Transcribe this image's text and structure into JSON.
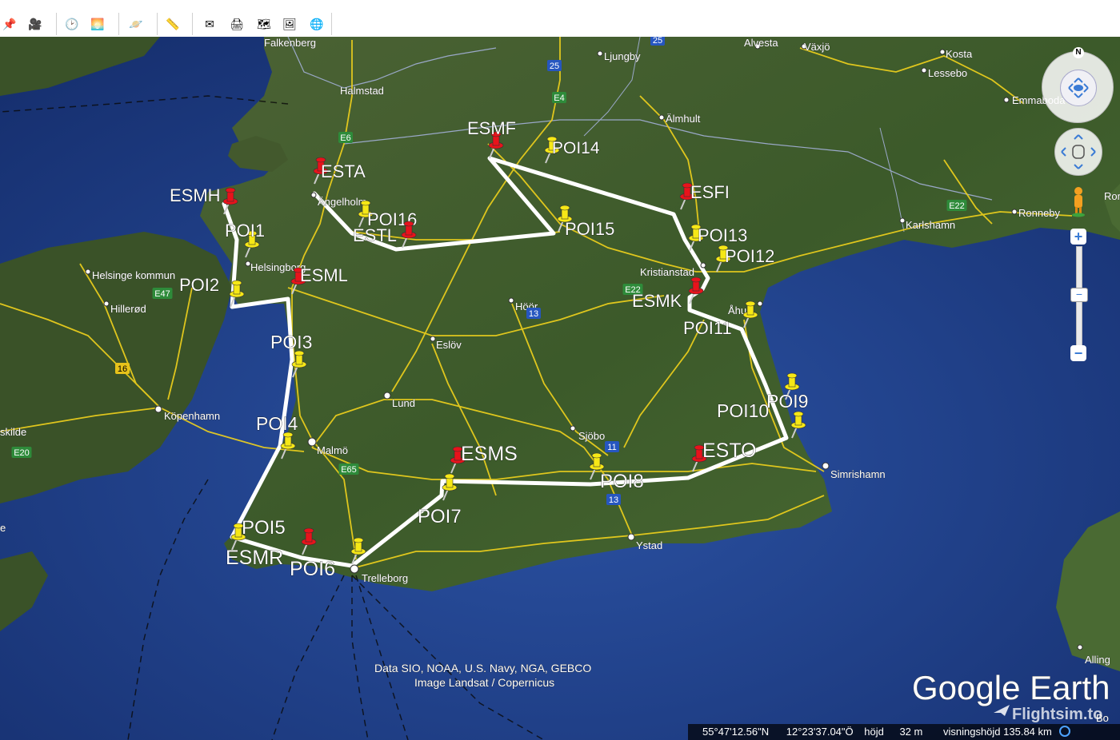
{
  "toolbar": {
    "buttons": [
      {
        "icon": "add-placemark-icon"
      },
      {
        "icon": "add-tour-icon"
      },
      {
        "icon": "historical-imagery-icon"
      },
      {
        "icon": "sunlight-icon"
      },
      {
        "icon": "planets-icon"
      },
      {
        "icon": "ruler-icon"
      },
      {
        "icon": "email-icon"
      },
      {
        "icon": "print-icon"
      },
      {
        "icon": "view-in-maps-icon"
      },
      {
        "icon": "save-image-icon"
      },
      {
        "icon": "globe-icon"
      }
    ]
  },
  "markers": [
    {
      "id": "ESMF",
      "color": "red"
    },
    {
      "id": "POI14",
      "color": "yellow"
    },
    {
      "id": "ESTA",
      "color": "red"
    },
    {
      "id": "ESMH",
      "color": "red"
    },
    {
      "id": "POI16",
      "color": "yellow"
    },
    {
      "id": "ESTL",
      "color": "red"
    },
    {
      "id": "POI15",
      "color": "yellow"
    },
    {
      "id": "ESFI",
      "color": "red"
    },
    {
      "id": "POI1",
      "color": "yellow"
    },
    {
      "id": "POI13",
      "color": "yellow"
    },
    {
      "id": "POI12",
      "color": "yellow"
    },
    {
      "id": "ESML",
      "color": "red"
    },
    {
      "id": "POI2",
      "color": "yellow"
    },
    {
      "id": "ESMK",
      "color": "red"
    },
    {
      "id": "POI11",
      "color": "yellow"
    },
    {
      "id": "POI3",
      "color": "yellow"
    },
    {
      "id": "POI9",
      "color": "yellow"
    },
    {
      "id": "POI10",
      "color": "yellow"
    },
    {
      "id": "POI4",
      "color": "yellow"
    },
    {
      "id": "ESMS",
      "color": "red"
    },
    {
      "id": "ESTO",
      "color": "red"
    },
    {
      "id": "POI8",
      "color": "yellow"
    },
    {
      "id": "POI7",
      "color": "yellow"
    },
    {
      "id": "POI5",
      "color": "yellow"
    },
    {
      "id": "ESMR",
      "color": "red"
    },
    {
      "id": "POI6",
      "color": "yellow"
    }
  ],
  "places": {
    "falkenberg": "Falkenberg",
    "halmstad": "Halmstad",
    "ljungby": "Ljungby",
    "alvesta": "Alvesta",
    "vaxjo": "Växjö",
    "kosta": "Kosta",
    "lessebo": "Lessebo",
    "emmaboda": "Emmaboda",
    "almhult": "Älmhult",
    "angelholm": "Ängelholm",
    "helsingborg": "Helsingborg",
    "helsinge": "Helsinge kommun",
    "hillerod": "Hillerød",
    "kristianstad": "Kristianstad",
    "karlshamn": "Karlshamn",
    "ronneby": "Ronneby",
    "ron": "Ron",
    "ahus": "Åhus",
    "hoor": "Höör",
    "eslov": "Eslöv",
    "lund": "Lund",
    "kopenhamn": "Köpenhamn",
    "skilde": "skilde",
    "malmo": "Malmö",
    "sjobo": "Sjöbo",
    "simrishamn": "Simrishamn",
    "ystad": "Ystad",
    "trelleborg": "Trelleborg",
    "alling": "Alling",
    "bo": "Bo",
    "e": "e"
  },
  "roads": {
    "e6": "E6",
    "e4": "E4",
    "r25": "25",
    "r25b": "25",
    "e22": "E22",
    "e22b": "E22",
    "e47": "E47",
    "r16": "16",
    "e20": "E20",
    "e65": "E65",
    "r11": "11",
    "r13": "13",
    "r13b": "13"
  },
  "credits": {
    "line1": "Data SIO, NOAA, U.S. Navy, NGA, GEBCO",
    "line2": "Image Landsat / Copernicus"
  },
  "watermark": {
    "logo": "Google Earth",
    "flightsim": "Flightsim.to"
  },
  "status": {
    "lat": "55°47'12.56\"N",
    "lon": "12°23'37.04\"Ö",
    "height_label": "höjd",
    "height": "32 m",
    "eye_alt": "visningshöjd 135.84 km"
  },
  "nav": {
    "north": "N"
  },
  "colors": {
    "sea": "#1d3d82",
    "land": "#3f5a2c",
    "route": "#ffffff",
    "road": "#f1d21c",
    "pin_red": "#e8131b",
    "pin_yellow": "#f6e816"
  }
}
